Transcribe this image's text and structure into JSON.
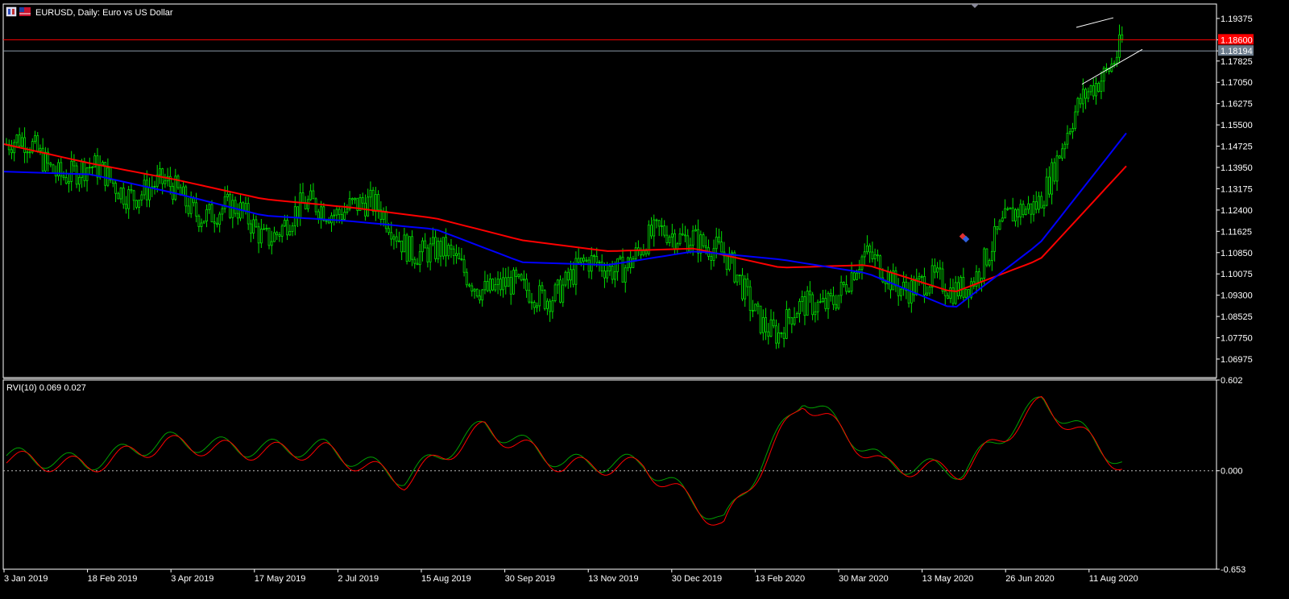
{
  "window": {
    "symbol_title": "EURUSD, Daily:  Euro vs US Dollar",
    "indicator_title": "RVI(10) 0.069 0.027"
  },
  "colors": {
    "background": "#000000",
    "frame": "#ffffff",
    "candle": "#00e000",
    "ma_fast": "#0000ff",
    "ma_slow": "#ff0000",
    "hline_red": "#ff0000",
    "hline_grey": "#8c9aa8",
    "rvi_main": "#00a000",
    "rvi_signal": "#ff0000",
    "trendline": "#ffffff"
  },
  "price_axis": {
    "ticks": [
      "1.19375",
      "1.18600",
      "1.18194",
      "1.17825",
      "1.17050",
      "1.16275",
      "1.15500",
      "1.14725",
      "1.13950",
      "1.13175",
      "1.12400",
      "1.11625",
      "1.10850",
      "1.10075",
      "1.09300",
      "1.08525",
      "1.07750",
      "1.06975"
    ],
    "red_line_value": "1.18600",
    "current_price": "1.18194"
  },
  "rvi_axis": {
    "ticks": [
      "0.602",
      "0.000",
      "-0.653"
    ]
  },
  "time_axis": {
    "labels": [
      "3 Jan 2019",
      "18 Feb 2019",
      "3 Apr 2019",
      "17 May 2019",
      "2 Jul 2019",
      "15 Aug 2019",
      "30 Sep 2019",
      "13 Nov 2019",
      "30 Dec 2019",
      "13 Feb 2020",
      "30 Mar 2020",
      "13 May 2020",
      "26 Jun 2020",
      "11 Aug 2020"
    ]
  },
  "chart_data": {
    "type": "line",
    "title": "EURUSD, Daily:  Euro vs US Dollar",
    "xlabel": "",
    "ylabel": "",
    "x": [
      "3 Jan 2019",
      "18 Feb 2019",
      "3 Apr 2019",
      "17 May 2019",
      "2 Jul 2019",
      "15 Aug 2019",
      "30 Sep 2019",
      "13 Nov 2019",
      "30 Dec 2019",
      "13 Feb 2020",
      "30 Mar 2020",
      "13 May 2020",
      "26 Jun 2020",
      "11 Aug 2020"
    ],
    "ylim": [
      1.063,
      1.199
    ],
    "series": [
      {
        "values": [
          1.148,
          1.136,
          1.129,
          1.117,
          1.128,
          1.107,
          1.092,
          1.104,
          1.118,
          1.079,
          1.104,
          1.093,
          1.129,
          1.188
        ]
      },
      {
        "values": [
          1.138,
          1.137,
          1.13,
          1.122,
          1.12,
          1.117,
          1.105,
          1.104,
          1.109,
          1.106,
          1.101,
          1.088,
          1.112,
          1.152
        ]
      },
      {
        "values": [
          1.148,
          1.141,
          1.135,
          1.128,
          1.125,
          1.121,
          1.113,
          1.109,
          1.11,
          1.103,
          1.104,
          1.094,
          1.106,
          1.14
        ]
      }
    ],
    "rvi": {
      "ylim": [
        -0.653,
        0.602
      ],
      "series": [
        {
          "values": [
            0.1,
            0.05,
            0.2,
            0.15,
            0.15,
            -0.05,
            0.3,
            0.05,
            0.05,
            -0.35,
            0.5,
            0.05,
            0.0,
            0.47,
            0.05
          ]
        },
        {
          "values": [
            0.08,
            0.03,
            0.18,
            0.13,
            0.13,
            -0.07,
            0.28,
            0.03,
            0.03,
            -0.37,
            0.47,
            0.03,
            0.0,
            0.45,
            0.03
          ]
        }
      ]
    }
  }
}
